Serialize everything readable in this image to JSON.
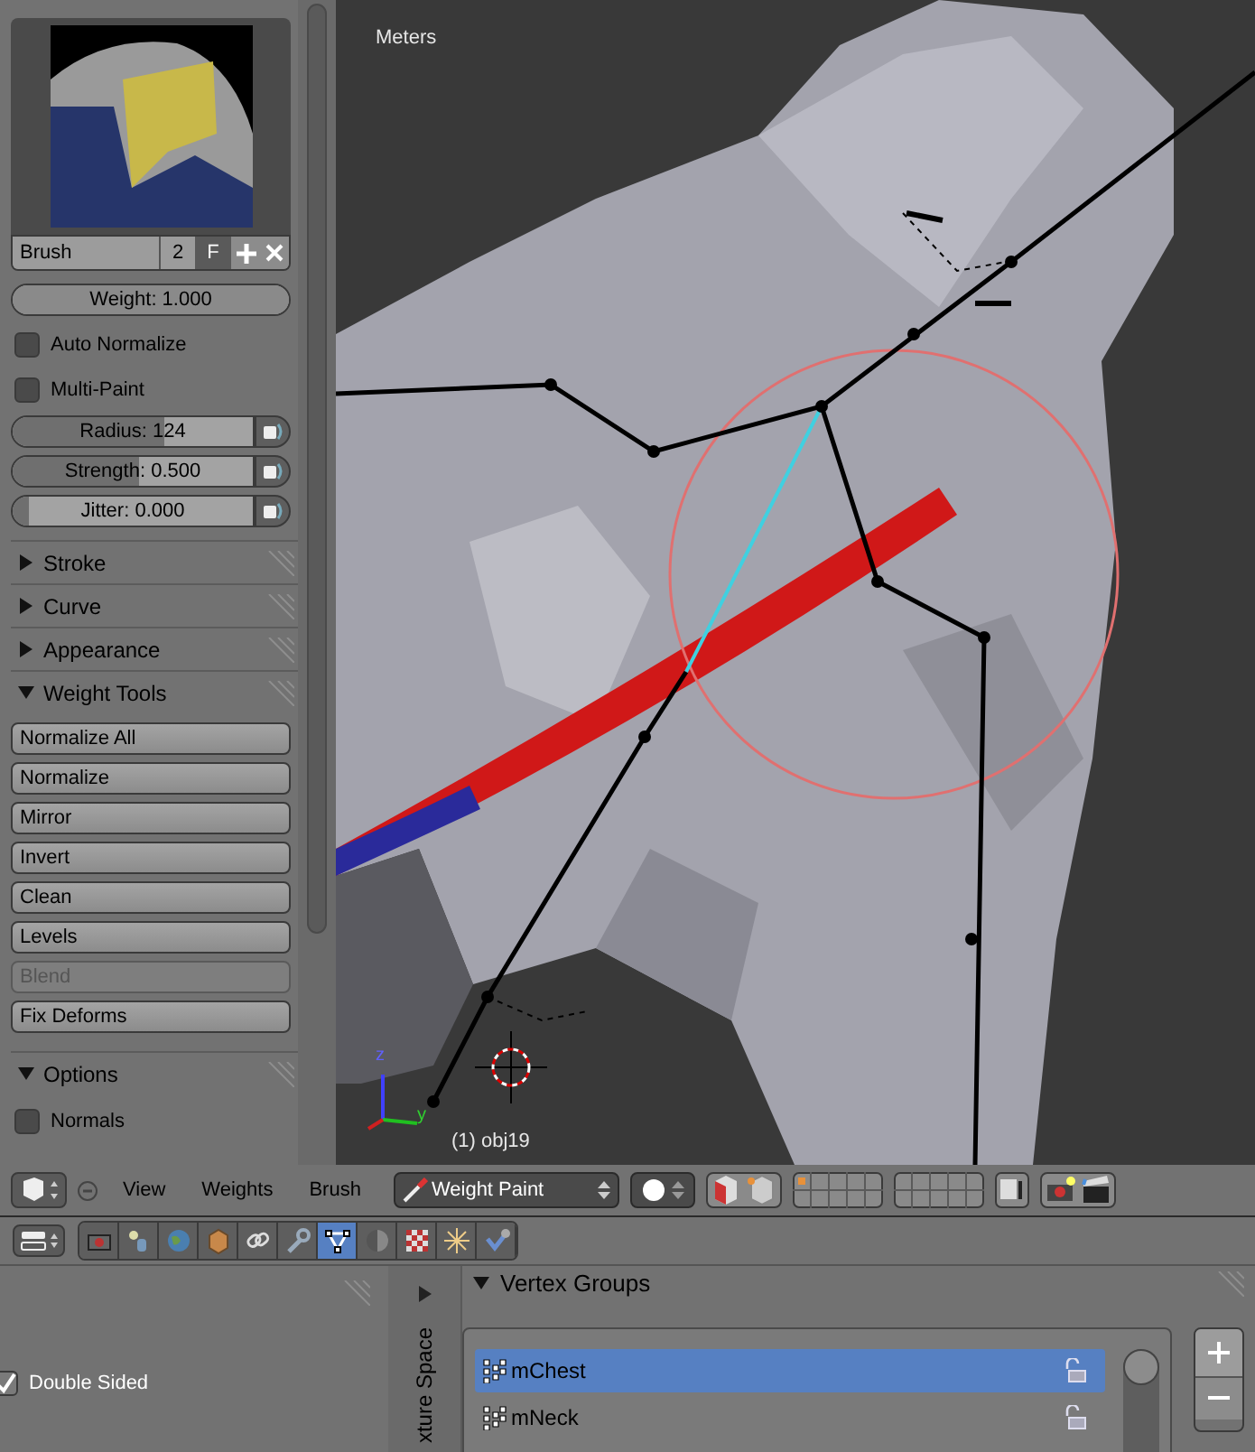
{
  "brush_panel": {
    "name": "Brush",
    "users": "2",
    "fake_user": "F",
    "weight": {
      "label": "Weight: 1.000",
      "level": 1.0
    },
    "checkboxes": [
      {
        "label": "Auto Normalize",
        "checked": false
      },
      {
        "label": "Multi-Paint",
        "checked": false
      }
    ],
    "sliders": [
      {
        "label": "Radius: 124",
        "level": 0.63
      },
      {
        "label": "Strength: 0.500",
        "level": 0.53
      },
      {
        "label": "Jitter: 0.000",
        "level": 0.07
      }
    ]
  },
  "sections": [
    {
      "title": "Stroke",
      "expanded": false
    },
    {
      "title": "Curve",
      "expanded": false
    },
    {
      "title": "Appearance",
      "expanded": false
    },
    {
      "title": "Weight Tools",
      "expanded": true,
      "buttons": [
        {
          "label": "Normalize All",
          "disabled": false
        },
        {
          "label": "Normalize",
          "disabled": false
        },
        {
          "label": "Mirror",
          "disabled": false
        },
        {
          "label": "Invert",
          "disabled": false
        },
        {
          "label": "Clean",
          "disabled": false
        },
        {
          "label": "Levels",
          "disabled": false
        },
        {
          "label": "Blend",
          "disabled": true
        },
        {
          "label": "Fix Deforms",
          "disabled": false
        }
      ]
    },
    {
      "title": "Options",
      "expanded": true,
      "checkboxes": [
        {
          "label": "Normals",
          "checked": false
        }
      ]
    }
  ],
  "viewport": {
    "units": "Meters",
    "object_label": "(1) obj19",
    "axis_labels": [
      "z",
      "y"
    ]
  },
  "header": {
    "menus": [
      "View",
      "Weights",
      "Brush"
    ],
    "mode": "Weight Paint"
  },
  "properties_tabs": [
    {
      "kind": "camera",
      "selected": false
    },
    {
      "kind": "scene",
      "selected": false
    },
    {
      "kind": "world",
      "selected": false
    },
    {
      "kind": "object",
      "selected": false
    },
    {
      "kind": "constraints",
      "selected": false
    },
    {
      "kind": "modifiers",
      "selected": false
    },
    {
      "kind": "mesh",
      "selected": true
    },
    {
      "kind": "material",
      "selected": false
    },
    {
      "kind": "texture",
      "selected": false
    },
    {
      "kind": "particles",
      "selected": false
    },
    {
      "kind": "physics",
      "selected": false
    }
  ],
  "properties": {
    "double_sided": {
      "label": "Double Sided",
      "checked": true
    },
    "side_tab": "xture Space",
    "vertex_groups": {
      "title": "Vertex Groups",
      "expanded": true,
      "items": [
        {
          "name": "mChest",
          "selected": true
        },
        {
          "name": "mNeck",
          "selected": false
        }
      ]
    }
  }
}
